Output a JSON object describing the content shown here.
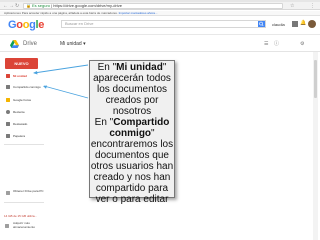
{
  "browser": {
    "url_secure": "Es seguro",
    "url_text": "https://drive.google.com/drive/my-drive",
    "bookmarks_label": "Aplicaciones",
    "bookmarks_tip": "Para acceder rápido a una página, añádela a esta barra de marcadores.",
    "bookmarks_link": "Importar marcadores ahora..."
  },
  "google": {
    "logo_letters": [
      "G",
      "o",
      "o",
      "g",
      "l",
      "e"
    ],
    "search_placeholder": "Buscar en Drive",
    "user_name": "claudia"
  },
  "drive": {
    "title": "Drive",
    "breadcrumb": "Mi unidad ▾"
  },
  "sidebar": {
    "new_label": "NUEVO",
    "items": [
      {
        "label": "Mi unidad",
        "color": "#db4437",
        "active": true
      },
      {
        "label": "Compartido conmigo",
        "color": "#7a7a7a",
        "active": false
      },
      {
        "label": "Google Fotos",
        "color": "#f4b400",
        "active": false
      },
      {
        "label": "Reciente",
        "color": "#7a7a7a",
        "active": false
      },
      {
        "label": "Destacado",
        "color": "#7a7a7a",
        "active": false
      },
      {
        "label": "Papelera",
        "color": "#7a7a7a",
        "active": false
      }
    ],
    "backup_label": "Obtener Drive para PC",
    "storage_text": "14 GB de 15 GB utiliza...",
    "upgrade_label": "Adquirir más almacenamiento"
  },
  "callout": {
    "line1_prefix": "En \"",
    "line1_bold": "Mi unidad",
    "line1_suffix": "\"",
    "line2": "aparecerán todos los documentos creados por nosotros",
    "line3_prefix": "En \"",
    "line3_bold": "Compartido conmigo",
    "line3_suffix": "\"",
    "line4": "encontraremos los documentos que otros usuarios han creado y nos han compartido para ver o para editar"
  },
  "colors": {
    "accent_red": "#db4437",
    "google_blue": "#4285f4"
  }
}
